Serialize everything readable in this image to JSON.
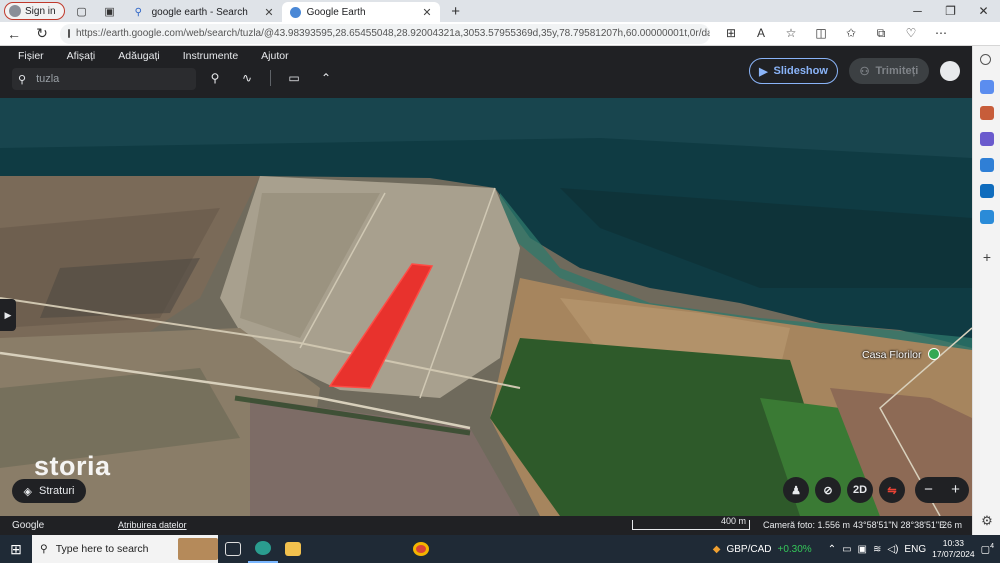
{
  "browser": {
    "profile_label": "Sign in",
    "tabs": [
      {
        "title": "google earth - Search",
        "active": false
      },
      {
        "title": "Google Earth",
        "active": true
      }
    ],
    "new_tab_glyph": "+",
    "url": "https://earth.google.com/web/search/tuzla/@43.98393595,28.65455048,28.92004321a,3053.57955369d,35y,78.79581207h,60.00000001t,0r/data=CigiJgokCd7I..."
  },
  "earth": {
    "menu": [
      "Fișier",
      "Afișați",
      "Adăugați",
      "Instrumente",
      "Ajutor"
    ],
    "search_value": "tuzla",
    "slideshow_label": "Slideshow",
    "share_label": "Trimiteți",
    "place_label": "Casa Florilor",
    "layers_label": "Straturi",
    "view_mode_label": "2D",
    "status": {
      "brand": "Google",
      "data_credit": "Atribuirea datelor",
      "scale_label": "400 m",
      "camera": "Cameră foto: 1.556 m",
      "coordinates": "43°58'51\"N 28°38'51\"E",
      "altitude": "26 m"
    },
    "polygon_color": "#e8322d",
    "sea_color": "#0f3b43",
    "field_color": "#2e5a2a"
  },
  "watermark": "storia",
  "taskbar": {
    "search_placeholder": "Type here to search",
    "fx_label": "GBP/CAD",
    "fx_change": "+0.30%",
    "language": "ENG",
    "time": "10:33",
    "date": "17/07/2024",
    "notification_count": "4"
  }
}
